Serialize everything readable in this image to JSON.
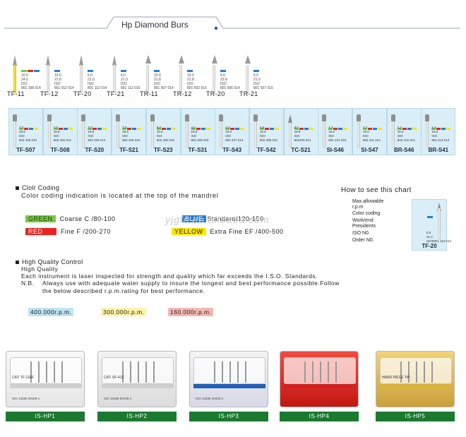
{
  "title": "Hp Diamond Burs",
  "colors": {
    "green_chip": "#7ac943",
    "red_chip": "#e8261f",
    "blue_chip": "#1f7fd4",
    "yellow_chip": "#ffe600",
    "label_bar": "#1b7a30",
    "card_bg": "#d9eef6"
  },
  "row1": [
    {
      "code": "TF-11",
      "chip": "red",
      "lines": [
        "10.0",
        "24.0",
        "ISO",
        "801 108 014"
      ]
    },
    {
      "code": "TF-12",
      "chip": "blue",
      "lines": [
        "10.0",
        "21.8",
        "ISO",
        "801 012 014"
      ]
    },
    {
      "code": "TF-20",
      "chip": "blue",
      "lines": [
        "6.0",
        "21.0",
        "ISO",
        "801 112 014"
      ]
    },
    {
      "code": "TF-21",
      "chip": "blue",
      "lines": [
        "6.0",
        "21.0",
        "ISO",
        "801 112 016"
      ]
    },
    {
      "code": "TR-11",
      "chip": "blue",
      "lines": [
        "10.0",
        "21.8",
        "ISO",
        "801 507 014"
      ]
    },
    {
      "code": "TR-12",
      "chip": "blue",
      "lines": [
        "10.0",
        "21.8",
        "ISO",
        "801 502 016"
      ]
    },
    {
      "code": "TR-20",
      "chip": "blue",
      "lines": [
        "6.0",
        "23.8",
        "ISO",
        "801 506 014"
      ]
    },
    {
      "code": "TR-21",
      "chip": "blue",
      "lines": [
        "6.0",
        "21.0",
        "ISO",
        "801 507 016"
      ]
    }
  ],
  "row2": [
    {
      "code": "TF-S07",
      "lines": [
        "7.0",
        "18.8",
        "ISO",
        "802 405 010"
      ]
    },
    {
      "code": "TF-S08",
      "lines": [
        "7.0",
        "18.8",
        "ISO",
        "802 402 012"
      ]
    },
    {
      "code": "TF-S20",
      "lines": [
        "7.0",
        "18.8",
        "ISO",
        "802 405 014"
      ]
    },
    {
      "code": "TF-S21",
      "lines": [
        "7.0",
        "18.8",
        "ISO",
        "802 405 016"
      ]
    },
    {
      "code": "TF-S23",
      "lines": [
        "5.0",
        "18.8",
        "ISO",
        "802 405 018"
      ]
    },
    {
      "code": "TF-S31",
      "lines": [
        "4.2",
        "18.8",
        "ISO",
        "802 405 016"
      ]
    },
    {
      "code": "TF-S43",
      "lines": [
        "4.2",
        "16.8",
        "ISO",
        "802 407 014"
      ]
    },
    {
      "code": "TF-S42",
      "lines": [
        "4.0",
        "16.8",
        "ISO",
        "802 405 012"
      ]
    },
    {
      "code": "TC-S21",
      "lines": [
        "8.0",
        "19.8",
        "ISO",
        "802409 014"
      ]
    },
    {
      "code": "SI-S46",
      "lines": [
        "1.3",
        "16.0",
        "ISO",
        "802 410 016"
      ]
    },
    {
      "code": "SI-S47",
      "lines": [
        "1.7",
        "16.0",
        "ISO",
        "802 411 014"
      ]
    },
    {
      "code": "BR-S46",
      "lines": [
        "1.2",
        "16.0",
        "ISO",
        "802 412 012"
      ]
    },
    {
      "code": "BR-S41",
      "lines": [
        "1.4",
        "16.0",
        "ISO",
        "802 413 014"
      ]
    }
  ],
  "color_coding": {
    "heading": "Clolr Coding",
    "sub": "Color coding indication is located at the top of the mandrel",
    "green": {
      "chip": "GREEN",
      "text": "Coarse  C   /80-100"
    },
    "blue": {
      "chip": "BLUE",
      "text": "Standard/120-150"
    },
    "red": {
      "chip": "RED",
      "text": "Fine  F  /200-270"
    },
    "yellow": {
      "chip": "YELLOW",
      "text": "Extra Fine  EF  /400-500"
    }
  },
  "watermark": "yjgfc.en.alibaba.com",
  "how_to": {
    "title": "How to see this chart",
    "rows": [
      "Max.allowable",
      "r.p.m",
      "Color coding",
      "Work/end",
      "Presidents",
      "ISO N0.",
      "Order N0."
    ],
    "card": {
      "code": "TF-20",
      "lines": [
        "6.0",
        "21.0",
        "ISO0801 112 014"
      ]
    }
  },
  "quality": {
    "heading": "High Quality Control",
    "sub": "High Quality",
    "line1": "Each instrument is laser inspected for strength and quality which far exceeds the I.S.O. Standards.",
    "nb_label": "N.B.",
    "nb1": "Always use with adequate water supply to insure the longest and best performance possible.Follow",
    "nb2": "the below described r.p.m.rating for best performance.",
    "rpm": [
      "400.000r.p.m.",
      "300.000r.p.m.",
      "160.000r.p.m."
    ]
  },
  "products": [
    {
      "code": "IS-HP1",
      "cat": "CAT:    TF-11EF",
      "iso": "ISO 13485  20109-1"
    },
    {
      "code": "IS-HP2",
      "cat": "CAT:    SF-41C",
      "iso": "ISO 13485  20109-1"
    },
    {
      "code": "IS-HP3",
      "cat": "",
      "iso": "ISO 13485  20109-1"
    },
    {
      "code": "IS-HP4",
      "cat": "",
      "iso": ""
    },
    {
      "code": "IS-HP5",
      "cat": "HAND PIECE TIP",
      "iso": ""
    }
  ]
}
